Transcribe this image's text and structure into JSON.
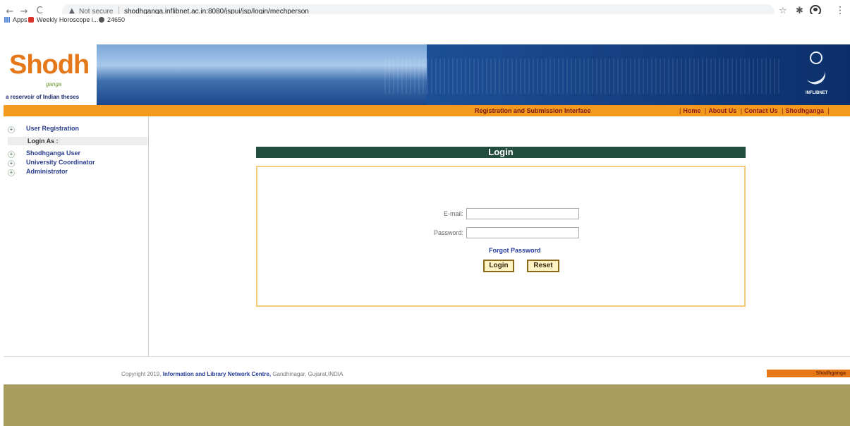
{
  "browser": {
    "back": "←",
    "forward": "→",
    "reload": "C",
    "warning_symbol": "▲",
    "not_secure": "Not secure",
    "url": "shodhganga.inflibnet.ac.in:8080/jspui/jsp/login/mechperson",
    "star": "☆",
    "extension": "✱",
    "menu": "⋮"
  },
  "bookmarks": [
    {
      "label": "Apps",
      "icon": "apps-icon"
    },
    {
      "label": "Weekly Horoscope i...",
      "icon": "bookmark-icon"
    },
    {
      "label": "24650",
      "icon": "globe-icon"
    }
  ],
  "header": {
    "logo_text": "Shodh",
    "logo_sub": "ganga",
    "logo_tagline": "a reservoir of Indian theses",
    "inflibnet_label": "INFLIBNET"
  },
  "navbar": {
    "title": "Registration and Submission Interface",
    "links": [
      "Home",
      "About Us",
      "Contact Us",
      "Shodhganga"
    ]
  },
  "sidebar": {
    "user_registration": "User Registration",
    "login_as": "Login As :",
    "items": [
      "Shodhganga User",
      "University Coordinator",
      "Administrator"
    ]
  },
  "login": {
    "title": "Login",
    "email_label": "E-mail:",
    "password_label": "Password:",
    "email_value": "",
    "password_value": "",
    "forgot": "Forgot Password",
    "login_button": "Login",
    "reset_button": "Reset"
  },
  "footer": {
    "copyright": "Copyright 2019,",
    "org": "Information and Library Network Centre,",
    "location": "Gandhinagar, Gujarat,INDIA",
    "badge": "Shodhganga"
  },
  "colors": {
    "orange_bar": "#f39a1e",
    "login_header": "#234d3e",
    "header_blue": "#0d3b7a",
    "bottom_band": "#a99c5f"
  }
}
